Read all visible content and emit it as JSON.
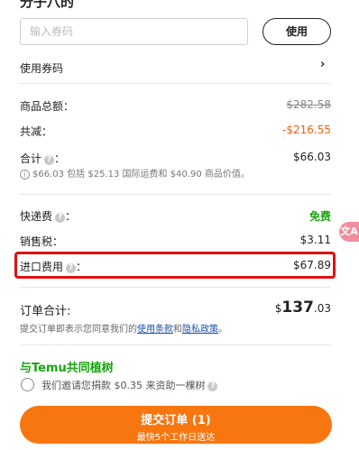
{
  "header": {
    "title_partial": "分子八的"
  },
  "coupon": {
    "placeholder": "输入券码",
    "apply_label": "使用",
    "use_coupon_label": "使用券码",
    "chevron": "›"
  },
  "summary": {
    "subtotal_label": "商品总额：",
    "subtotal_value": "$282.58",
    "discount_label": "共减：",
    "discount_value": "-$216.55",
    "total_label": "合计",
    "total_colon": "：",
    "total_value": "$66.03",
    "total_note": "$66.03 包括 $25.13 国际运费和 $40.90 商品价值。"
  },
  "fees": {
    "shipping_label": "快递费",
    "shipping_value": "免费",
    "tax_label": "销售税：",
    "tax_value": "$3.11",
    "import_label": "进口费用",
    "import_colon": "：",
    "import_value": "$67.89"
  },
  "order": {
    "total_label": "订单合计:",
    "currency": "$",
    "amount_main": "137",
    "amount_cents": ".03",
    "terms_prefix": "提交订单即表示您同意我们的",
    "terms_link": "使用条款",
    "terms_and": "和",
    "privacy_link": "隐私政策",
    "terms_suffix": "。"
  },
  "tree": {
    "title": "与Temu共同植树",
    "text": "我们邀请您捐款 $0.35 来资助一棵树"
  },
  "submit": {
    "label": "提交订单 (1)",
    "sublabel": "最快5个工作日送达"
  },
  "icons": {
    "question": "?",
    "info": "i",
    "translate": "文A"
  },
  "colors": {
    "accent_orange": "#f77610",
    "discount_orange": "#f2600c",
    "green": "#19a310",
    "highlight_red": "#e01010",
    "link_blue": "#1a4fa8"
  }
}
